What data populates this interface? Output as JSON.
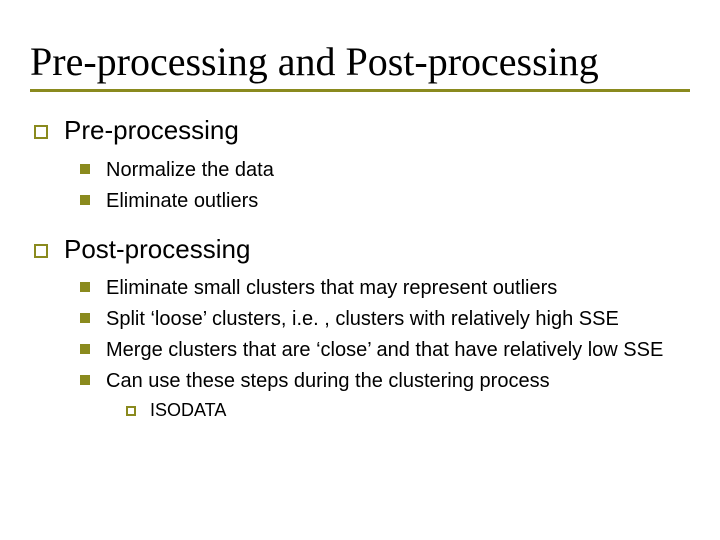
{
  "title": "Pre-processing and Post-processing",
  "sections": [
    {
      "heading": "Pre-processing",
      "items": [
        {
          "text": "Normalize the data"
        },
        {
          "text": "Eliminate outliers"
        }
      ]
    },
    {
      "heading": "Post-processing",
      "items": [
        {
          "text": "Eliminate small clusters that may represent outliers"
        },
        {
          "text": "Split ‘loose’ clusters, i.e. , clusters with relatively high SSE"
        },
        {
          "text": "Merge clusters that are ‘close’ and that have relatively low SSE"
        },
        {
          "text": "Can use these steps during the clustering process",
          "sub": [
            {
              "text": "ISODATA"
            }
          ]
        }
      ]
    }
  ],
  "colors": {
    "accent": "#8a8a1e"
  }
}
